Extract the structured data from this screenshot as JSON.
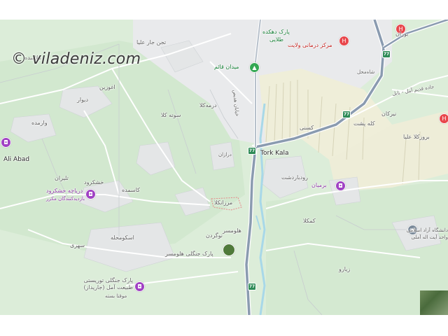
{
  "watermark": "© viladeniz.com",
  "places": {
    "tork_kala": "Tork Kala",
    "ali_abad": "Ali Abad",
    "maydan_qaem": "میدان قائم",
    "park_dehkadeh": "پارک دهکده",
    "talaei": "طلایی",
    "markaz_darmani": "مرکز درمانی ولایت",
    "boran": "بوران",
    "shahmahal": "شاه‌محل",
    "tejan": "تجن جار علیا",
    "molayesh": "ملاسده",
    "aghoozin": "اغوزین",
    "divar": "دیوار",
    "varemadeh": "وارمده",
    "dorme_kola": "درمه‌کلا",
    "sowteh_kola": "سوته کلا",
    "kasani": "کسنی",
    "kaleh_posht": "کله پشت",
    "nirkan": "نیرکان",
    "barozkola": "بروزکلا علیا",
    "darbazan": "درازان",
    "roodbardasht": "رودباردشت",
    "barmian": "برمیان",
    "talran": "تلیران",
    "khoshkrood": "خشکرود",
    "daryacheh": "دریاچه خشکرود",
    "daryacheh_sub": "بازدیدکنندگان مکرر",
    "kasmadeh": "کاسمده",
    "marzankola": "مرزانکلا",
    "halomsar": "هلومسر",
    "noogerdan": "نوگردن",
    "park_jangali": "پارک جنگلی هلومسر",
    "eskomahaleh": "اسکومحله",
    "sohri": "سهری",
    "kamkola": "کمکلا",
    "zirab": "زیارو",
    "daneshgah": "دانشگاه آزاد اسلامی واحد آیت اله آملی",
    "park_touristi": "پارک جنگلی توریستی طبیعت آمل (جاریداز)",
    "park_touristi_sub": "موقتا بسته",
    "highway_badge": "77",
    "road_khiaban": "خیابان هدیص",
    "road_amol": "جاده قدیم آمل - بابل"
  },
  "colors": {
    "forest": "#cfe8cf",
    "urban": "#e6e8ea",
    "farmland": "#ecebd8",
    "highway": "#7f8ea3",
    "road": "#ffffff",
    "river": "#a8d8e8",
    "accent_red": "#e8474c",
    "accent_green": "#34a853",
    "accent_purple": "#a142c4"
  },
  "icons": {
    "hospital": "hospital-icon",
    "park": "tree-icon",
    "attraction": "camera-icon",
    "highway": "highway-shield-icon"
  }
}
